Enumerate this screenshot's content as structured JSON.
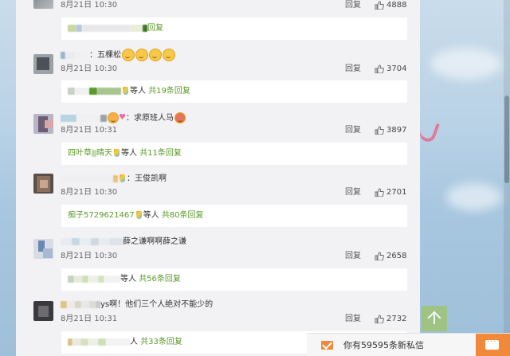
{
  "page": {
    "colors": {
      "accent_green": "#5a9a2a",
      "message_orange": "#f08a3a",
      "panel": "#f2f2f5"
    }
  },
  "comments": [
    {
      "text": "",
      "date": "8月21日 10:30",
      "reply_label": "回复",
      "likes": "4888",
      "sub": {
        "suffix": "",
        "link": "回复"
      }
    },
    {
      "text": "：五棵松",
      "date": "8月21日 10:30",
      "reply_label": "回复",
      "likes": "3704",
      "sub": {
        "suffix": "等人",
        "link": "共19条回复"
      }
    },
    {
      "text": "：求原班人马",
      "date": "8月21日 10:31",
      "reply_label": "回复",
      "likes": "3897",
      "sub": {
        "name_visible": "四叶草",
        "name_visible2": "晴天",
        "suffix": "等人",
        "link": "共11条回复"
      }
    },
    {
      "text": "：王俊凯啊",
      "date": "8月21日 10:30",
      "reply_label": "回复",
      "likes": "2701",
      "sub": {
        "name_visible": "痴子5729621467",
        "suffix": "等人",
        "link": "共80条回复"
      }
    },
    {
      "text": "薛之谦啊啊薛之谦",
      "date": "8月21日 10:30",
      "reply_label": "回复",
      "likes": "2658",
      "sub": {
        "suffix": "等人",
        "link": "共56条回复"
      }
    },
    {
      "text": "ys啊！他们三个人绝对不能少的",
      "date": "8月21日 10:31",
      "reply_label": "回复",
      "likes": "2732",
      "sub": {
        "suffix": "人",
        "link": "共33条回复"
      }
    }
  ],
  "message_bar": {
    "text": "你有59595条新私信"
  },
  "icons": {
    "like": "thumbs-up-icon",
    "scroll_top": "arrow-up-icon",
    "message": "envelope-icon",
    "chat": "chat-bubble-icon"
  }
}
